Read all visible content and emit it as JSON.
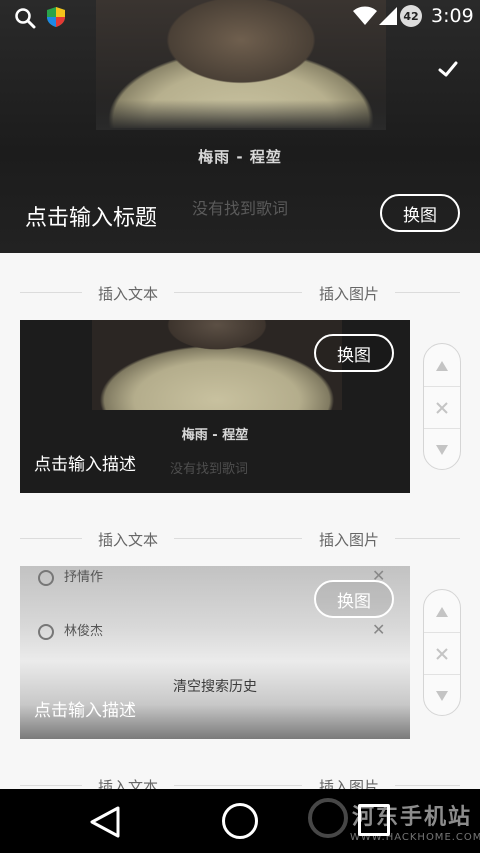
{
  "status_bar": {
    "time": "3:09",
    "battery_level": "42",
    "icons": [
      "search-icon",
      "shield-icon",
      "wifi-icon",
      "signal-icon",
      "battery-icon"
    ]
  },
  "header": {
    "song_title": "梅雨 - 程堃",
    "lyrics_message": "没有找到歌词",
    "title_placeholder": "点击输入标题",
    "swap_label": "换图",
    "confirm_icon": "check-icon"
  },
  "sections": [
    {
      "insert_text": "插入文本",
      "insert_image": "插入图片",
      "card": {
        "caption_song": "梅雨 - 程堃",
        "caption_lyrics": "没有找到歌词",
        "description_placeholder": "点击输入描述",
        "swap_label": "换图"
      },
      "controls": [
        "triangle-up-icon",
        "close-icon",
        "triangle-down-icon"
      ]
    },
    {
      "insert_text": "插入文本",
      "insert_image": "插入图片",
      "card": {
        "list_items": [
          "抒情作",
          "林俊杰"
        ],
        "center_message": "清空搜索历史",
        "description_placeholder": "点击输入描述",
        "swap_label": "换图"
      },
      "controls": [
        "triangle-up-icon",
        "close-icon",
        "triangle-down-icon"
      ]
    },
    {
      "insert_text": "插入文本",
      "insert_image": "插入图片"
    }
  ],
  "watermark": {
    "text": "河东手机站",
    "url": "WWW.HACKHOME.COM"
  },
  "colors": {
    "header_bg": "#222222",
    "page_bg": "#f7f7f7",
    "nav_bg": "#000000"
  }
}
